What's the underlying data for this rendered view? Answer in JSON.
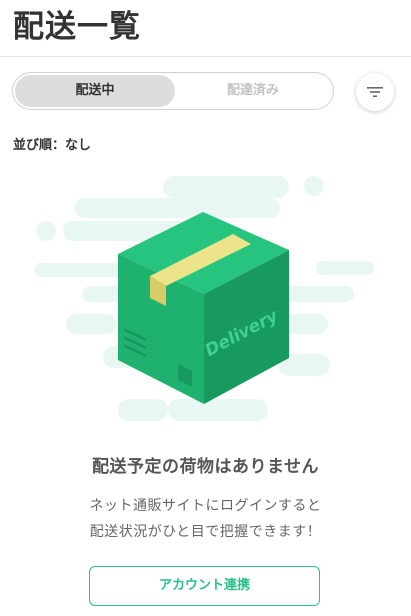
{
  "header": {
    "title": "配送一覧"
  },
  "tabs": [
    {
      "label": "配送中",
      "active": true
    },
    {
      "label": "配達済み",
      "active": false
    }
  ],
  "sort": {
    "button_icon": "sort-icon",
    "label": "並び順：なし"
  },
  "illustration": {
    "box_text": "Delivery",
    "colors": {
      "cloud": "#e8f7f1",
      "box_front": "#1fb26f",
      "box_side": "#189a5e",
      "box_top": "#27c47f",
      "tape": "#ece48a",
      "tape_side": "#d8cc66",
      "text": "#3fd18d"
    }
  },
  "empty_state": {
    "title": "配送予定の荷物はありません",
    "line1": "ネット通販サイトにログインすると",
    "line2": "配送状況がひと目で把握できます！"
  },
  "actions": {
    "link_account_label": "アカウント連携",
    "accent_color": "#28c08a"
  }
}
